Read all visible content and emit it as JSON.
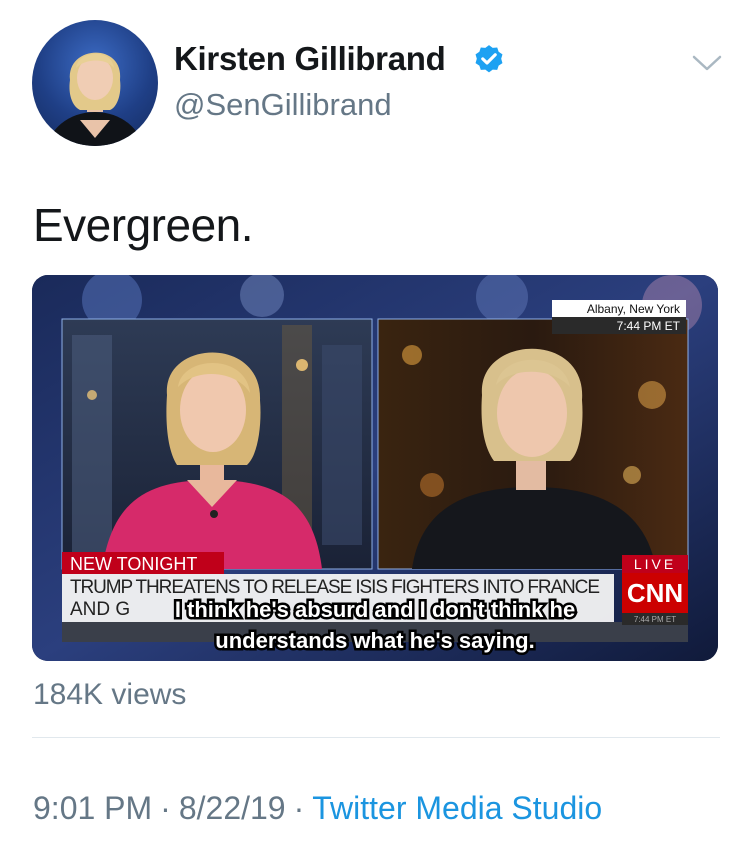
{
  "author": {
    "name": "Kirsten Gillibrand",
    "handle": "@SenGillibrand"
  },
  "tweet": {
    "text": "Evergreen."
  },
  "video": {
    "location": "Albany, New York",
    "time": "7:44 PM ET",
    "lower_third_label": "NEW TONIGHT",
    "headline_line1": "TRUMP THREATENS TO RELEASE ISIS FIGHTERS INTO FRANCE",
    "headline_line2": "AND G",
    "live_label": "LIVE",
    "network": "CNN",
    "network_time": "7:44 PM ET",
    "caption_line1": "I think he's absurd and I don't think he",
    "caption_line2": "understands what he's saying."
  },
  "stats": {
    "views": "184K views"
  },
  "footer": {
    "time": "9:01 PM",
    "date": "8/22/19",
    "separator": "·",
    "source": "Twitter Media Studio"
  },
  "colors": {
    "verified": "#1da1f2",
    "link": "#1b95e0",
    "muted": "#657786",
    "cnn_red": "#cc0000",
    "dress_pink": "#d62a6a"
  },
  "icons": {
    "verified": "verified-badge-icon",
    "menu": "chevron-down-icon"
  }
}
